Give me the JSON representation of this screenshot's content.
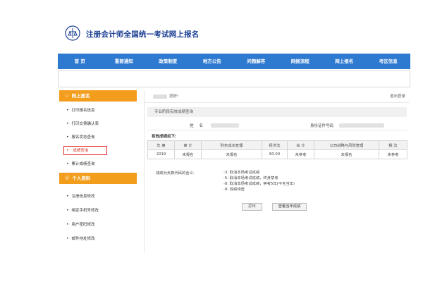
{
  "header": {
    "site_title": "注册会计师全国统一考试网上报名"
  },
  "nav": {
    "items": [
      "首 页",
      "重要通知",
      "政策制度",
      "地方公告",
      "问题解答",
      "网报流程",
      "网上报名",
      "考区信息"
    ]
  },
  "sidebar": {
    "sections": [
      {
        "title": "网上报名",
        "items": [
          "打印报名信息",
          "打印交费确认表",
          "报名状态查询",
          "成绩查询",
          "累计成绩查询"
        ]
      },
      {
        "title": "个人资料",
        "items": [
          "注册信息修改",
          "绑定手机号修改",
          "用户密码修改",
          "邮件地址修改"
        ]
      }
    ]
  },
  "main": {
    "greeting": "您好!",
    "logout": "退出登录",
    "query_title": "专业阶段有效成绩查询",
    "name_label": "姓 名",
    "id_label": "身份证件号码",
    "valid_scores_label": "有效成绩如下:",
    "table": {
      "headers": [
        "年 度",
        "审 计",
        "财务成本管理",
        "经济法",
        "会 计",
        "公司战略与风险管理",
        "税 法"
      ],
      "rows": [
        [
          "2019",
          "未报名",
          "未报名",
          "60.00",
          "未参考",
          "未报名",
          "未参考"
        ]
      ]
    },
    "notes_title": "成绩为负数代码的含义:",
    "notes": [
      "-3: 取消本场考试成绩",
      "-5: 取消本场考试成绩，终身禁考",
      "-8: 取消本场考试成绩，禁考5年(不含当年)",
      "-9: 成绩待查"
    ],
    "buttons": {
      "print": "打印",
      "view_current": "查看当年成绩"
    }
  },
  "colors": {
    "nav_blue": "#2e7ad1",
    "sidebar_orange": "#f39d1d",
    "highlight_red": "#e42a2a",
    "title_blue": "#1b3f93"
  }
}
